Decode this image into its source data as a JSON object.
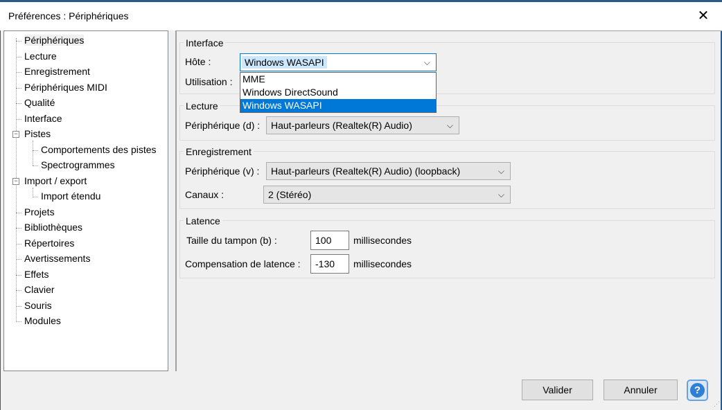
{
  "window": {
    "title": "Préférences : Périphériques",
    "close": "✕"
  },
  "tree": {
    "items": [
      {
        "label": "Périphériques"
      },
      {
        "label": "Lecture"
      },
      {
        "label": "Enregistrement"
      },
      {
        "label": "Périphériques MIDI"
      },
      {
        "label": "Qualité"
      },
      {
        "label": "Interface"
      },
      {
        "label": "Pistes"
      },
      {
        "label": "Comportements des pistes"
      },
      {
        "label": "Spectrogrammes"
      },
      {
        "label": "Import / export"
      },
      {
        "label": "Import étendu"
      },
      {
        "label": "Projets"
      },
      {
        "label": "Bibliothèques"
      },
      {
        "label": "Répertoires"
      },
      {
        "label": "Avertissements"
      },
      {
        "label": "Effets"
      },
      {
        "label": "Clavier"
      },
      {
        "label": "Souris"
      },
      {
        "label": "Modules"
      }
    ],
    "expander_symbol": "−"
  },
  "interface": {
    "title": "Interface",
    "host_label": "Hôte :",
    "host_value": "Windows WASAPI",
    "usage_label": "Utilisation :",
    "dropdown_options": [
      "MME",
      "Windows DirectSound",
      "Windows WASAPI"
    ]
  },
  "playback": {
    "title": "Lecture",
    "device_label": "Périphérique (d) :",
    "device_value": "Haut-parleurs (Realtek(R) Audio)"
  },
  "recording": {
    "title": "Enregistrement",
    "device_label": "Périphérique (v) :",
    "device_value": "Haut-parleurs (Realtek(R) Audio) (loopback)",
    "channels_label": "Canaux :",
    "channels_value": "2 (Stéréo)"
  },
  "latency": {
    "title": "Latence",
    "buffer_label": "Taille du tampon (b) :",
    "buffer_value": "100",
    "buffer_unit": "millisecondes",
    "comp_label": "Compensation de latence :",
    "comp_value": "-130",
    "comp_unit": "millisecondes"
  },
  "buttons": {
    "ok": "Valider",
    "cancel": "Annuler",
    "help": "?"
  },
  "icons": {
    "chevron": "⌵"
  },
  "colors": {
    "accent": "#0078d7",
    "highlight": "#cce8ff",
    "title_border": "#2b5a8a"
  }
}
